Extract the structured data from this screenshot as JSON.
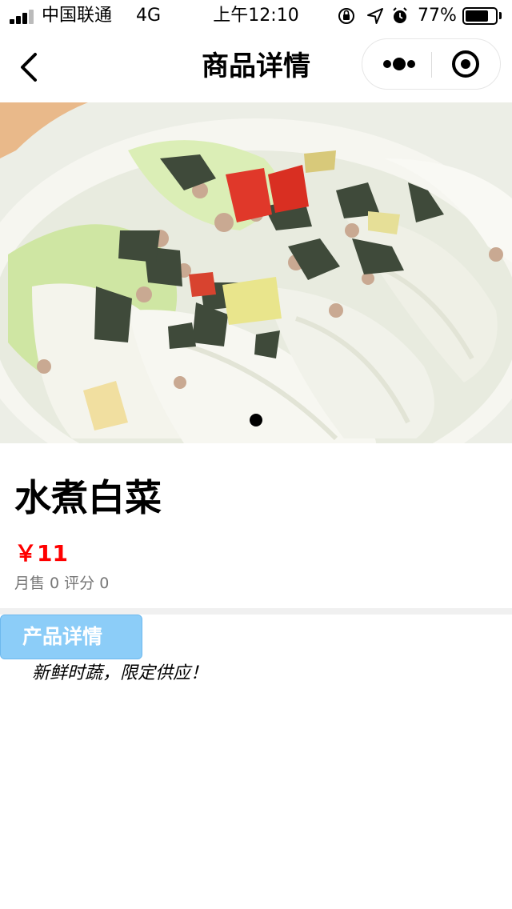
{
  "status_bar": {
    "carrier": "中国联通",
    "network": "4G",
    "time": "上午12:10",
    "battery": "77%",
    "battery_level": 0.77,
    "icons": [
      "orientation-lock-icon",
      "location-arrow-icon",
      "alarm-icon"
    ]
  },
  "nav": {
    "title": "商品详情",
    "back_icon": "chevron-left-icon",
    "more_icon": "more-dots-icon",
    "close_icon": "target-circle-icon"
  },
  "gallery": {
    "image": "napa cabbage dish photo",
    "page_count": 1,
    "current_page": 1
  },
  "product": {
    "name": "水煮白菜",
    "price": "￥11",
    "stats": "月售 0  评分 0",
    "price_color": "#ff0000"
  },
  "detail": {
    "tab_label": "产品详情",
    "tab_color": "#8ccdf8",
    "description": "新鲜时蔬，限定供应！"
  }
}
